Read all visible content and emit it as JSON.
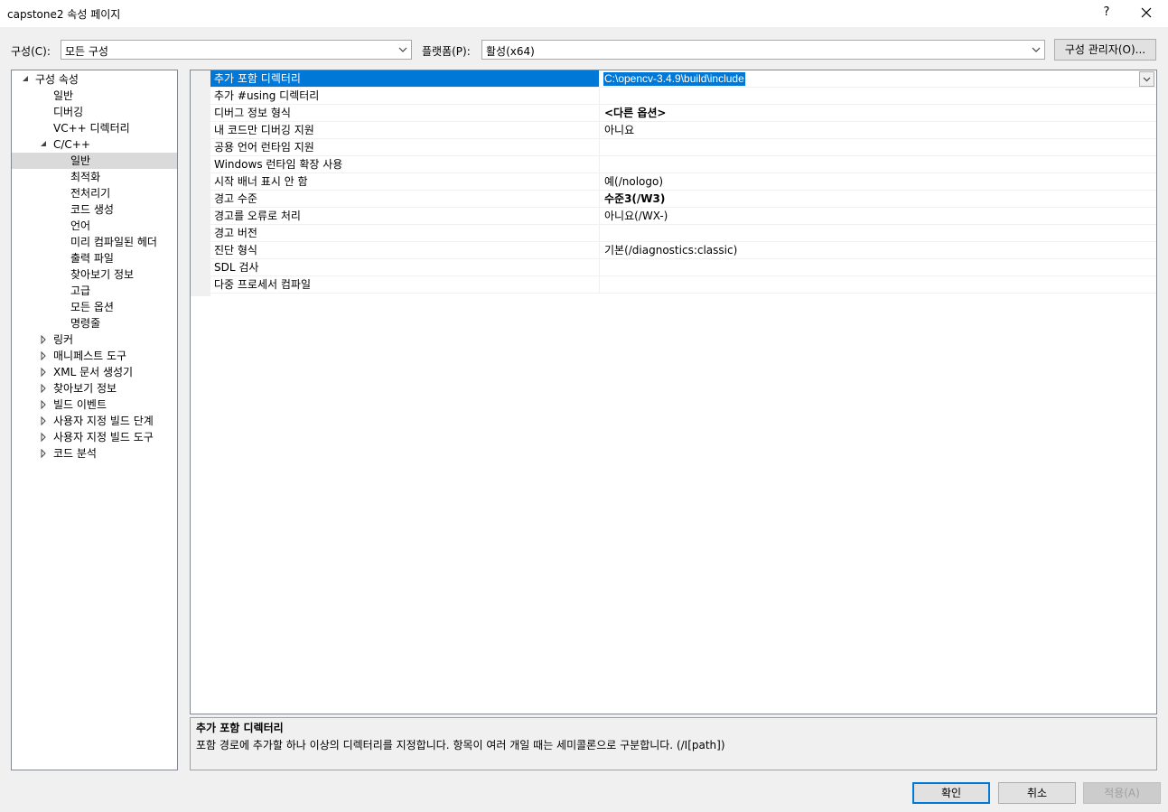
{
  "window": {
    "title": "capstone2 속성 페이지",
    "help": "?",
    "close_icon": "close-icon"
  },
  "toolbar": {
    "config_label": "구성(C):",
    "config_value": "모든 구성",
    "platform_label": "플랫폼(P):",
    "platform_value": "활성(x64)",
    "config_manager": "구성 관리자(O)..."
  },
  "tree": {
    "items": [
      {
        "label": "구성 속성",
        "level": 0,
        "state": "expanded"
      },
      {
        "label": "일반",
        "level": 1,
        "state": "leaf"
      },
      {
        "label": "디버깅",
        "level": 1,
        "state": "leaf"
      },
      {
        "label": "VC++ 디렉터리",
        "level": 1,
        "state": "leaf"
      },
      {
        "label": "C/C++",
        "level": 1,
        "state": "expanded"
      },
      {
        "label": "일반",
        "level": 2,
        "state": "leaf",
        "selected": true
      },
      {
        "label": "최적화",
        "level": 2,
        "state": "leaf"
      },
      {
        "label": "전처리기",
        "level": 2,
        "state": "leaf"
      },
      {
        "label": "코드 생성",
        "level": 2,
        "state": "leaf"
      },
      {
        "label": "언어",
        "level": 2,
        "state": "leaf"
      },
      {
        "label": "미리 컴파일된 헤더",
        "level": 2,
        "state": "leaf"
      },
      {
        "label": "출력 파일",
        "level": 2,
        "state": "leaf"
      },
      {
        "label": "찾아보기 정보",
        "level": 2,
        "state": "leaf"
      },
      {
        "label": "고급",
        "level": 2,
        "state": "leaf"
      },
      {
        "label": "모든 옵션",
        "level": 2,
        "state": "leaf"
      },
      {
        "label": "명령줄",
        "level": 2,
        "state": "leaf"
      },
      {
        "label": "링커",
        "level": 1,
        "state": "collapsed"
      },
      {
        "label": "매니페스트 도구",
        "level": 1,
        "state": "collapsed"
      },
      {
        "label": "XML 문서 생성기",
        "level": 1,
        "state": "collapsed"
      },
      {
        "label": "찾아보기 정보",
        "level": 1,
        "state": "collapsed"
      },
      {
        "label": "빌드 이벤트",
        "level": 1,
        "state": "collapsed"
      },
      {
        "label": "사용자 지정 빌드 단계",
        "level": 1,
        "state": "collapsed"
      },
      {
        "label": "사용자 지정 빌드 도구",
        "level": 1,
        "state": "collapsed"
      },
      {
        "label": "코드 분석",
        "level": 1,
        "state": "collapsed"
      }
    ]
  },
  "grid": {
    "rows": [
      {
        "name": "추가 포함 디렉터리",
        "value": "C:\\opencv-3.4.9\\build\\include",
        "selected": true,
        "bold": false
      },
      {
        "name": "추가 #using 디렉터리",
        "value": "",
        "bold": false
      },
      {
        "name": "디버그 정보 형식",
        "value": "<다른 옵션>",
        "bold": true
      },
      {
        "name": "내 코드만 디버깅 지원",
        "value": "아니요",
        "bold": false
      },
      {
        "name": "공용 언어 런타임 지원",
        "value": "",
        "bold": false
      },
      {
        "name": "Windows 런타임 확장 사용",
        "value": "",
        "bold": false
      },
      {
        "name": "시작 배너 표시 안 함",
        "value": "예(/nologo)",
        "bold": false
      },
      {
        "name": "경고 수준",
        "value": "수준3(/W3)",
        "bold": true
      },
      {
        "name": "경고를 오류로 처리",
        "value": "아니요(/WX-)",
        "bold": false
      },
      {
        "name": "경고 버전",
        "value": "",
        "bold": false
      },
      {
        "name": "진단 형식",
        "value": "기본(/diagnostics:classic)",
        "bold": false
      },
      {
        "name": "SDL 검사",
        "value": "",
        "bold": false
      },
      {
        "name": "다중 프로세서 컴파일",
        "value": "",
        "bold": false
      }
    ]
  },
  "description": {
    "title": "추가 포함 디렉터리",
    "body": "포함 경로에 추가할 하나 이상의 디렉터리를 지정합니다. 항목이 여러 개일 때는 세미콜론으로 구분합니다.      (/I[path])"
  },
  "buttons": {
    "ok": "확인",
    "cancel": "취소",
    "apply": "적용(A)"
  },
  "colors": {
    "selection": "#0078d7",
    "tree_selection": "#dadada"
  }
}
